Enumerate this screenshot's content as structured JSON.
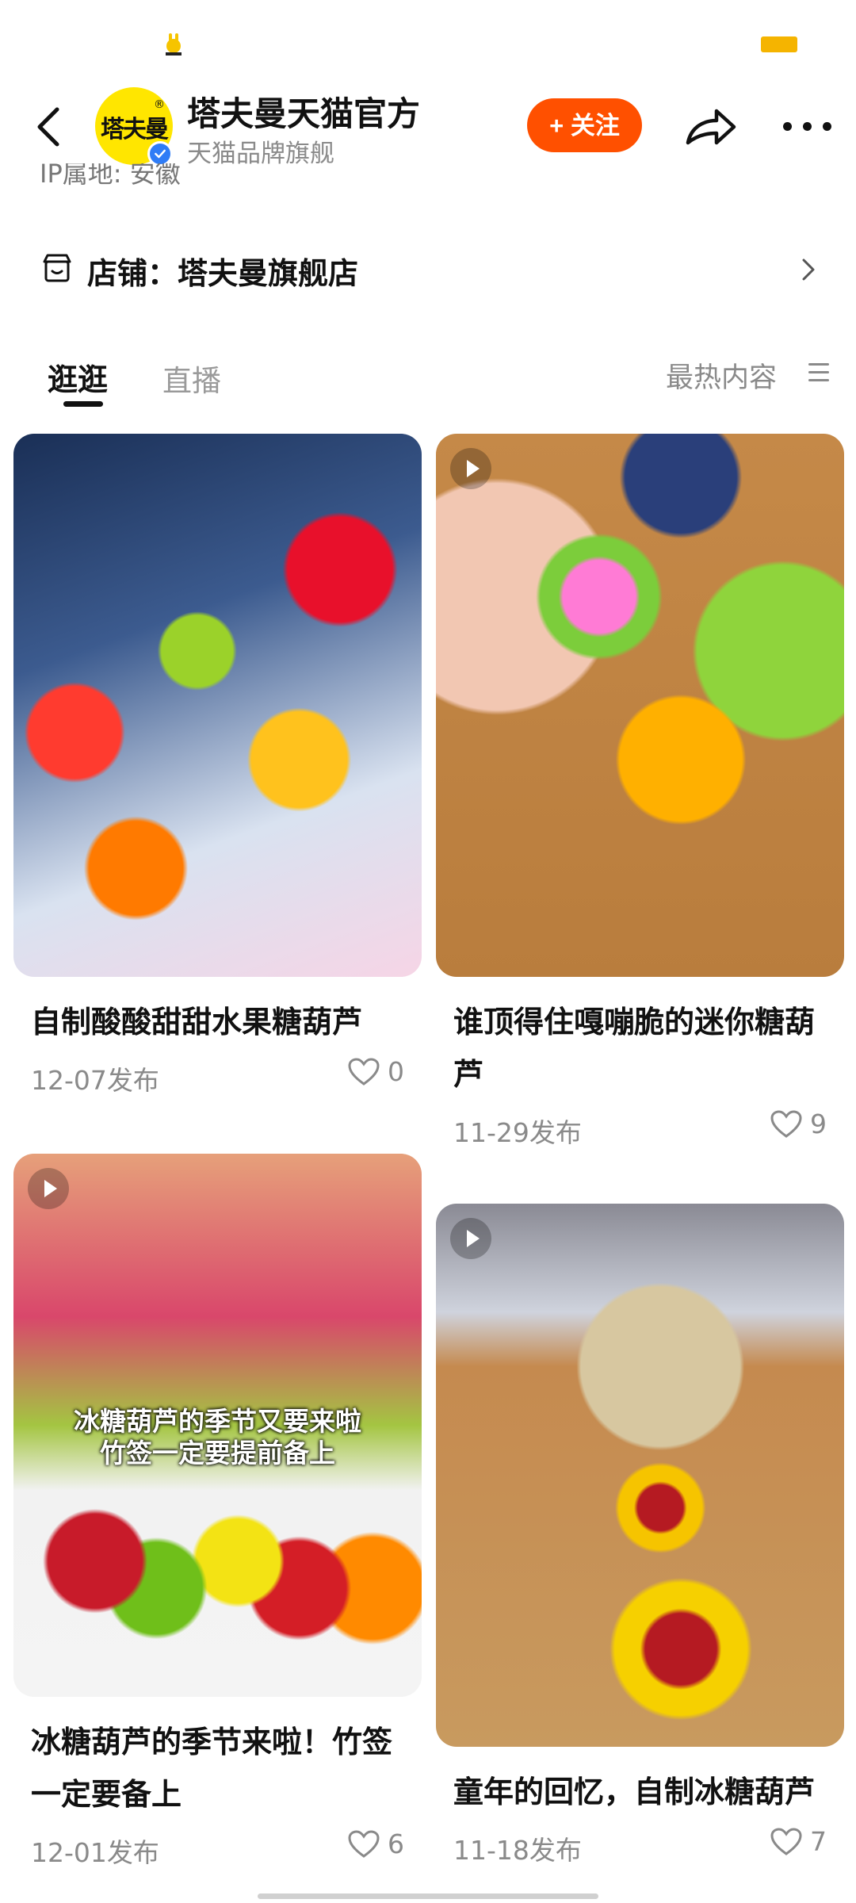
{
  "header": {
    "shop_name": "塔夫曼天猫官方",
    "shop_subtitle": "天猫品牌旗舰",
    "avatar_text": "塔夫曼",
    "follow_label": "+ 关注"
  },
  "ip_location": "IP属地: 安徽",
  "store": {
    "label": "店铺：塔夫曼旗舰店"
  },
  "tabs": {
    "items": [
      "逛逛",
      "直播"
    ],
    "active": "逛逛",
    "sort_label": "最热内容"
  },
  "cards": [
    {
      "title": "自制酸酸甜甜水果糖葫芦",
      "date": "12-07发布",
      "likes": "0"
    },
    {
      "title": "谁顶得住嘎嘣脆的迷你糖葫芦",
      "date": "11-29发布",
      "likes": "9"
    },
    {
      "title": "冰糖葫芦的季节来啦！竹签一定要备上",
      "date": "12-01发布",
      "likes": "6",
      "overlay_text": [
        "冰糖葫芦的季节又要来啦",
        "竹签一定要提前备上"
      ]
    },
    {
      "title": "童年的回忆，自制冰糖葫芦",
      "date": "11-18发布",
      "likes": "7"
    }
  ],
  "colors": {
    "accent": "#ff5000",
    "verified": "#2f7cf6",
    "avatar_bg": "#ffe600"
  }
}
